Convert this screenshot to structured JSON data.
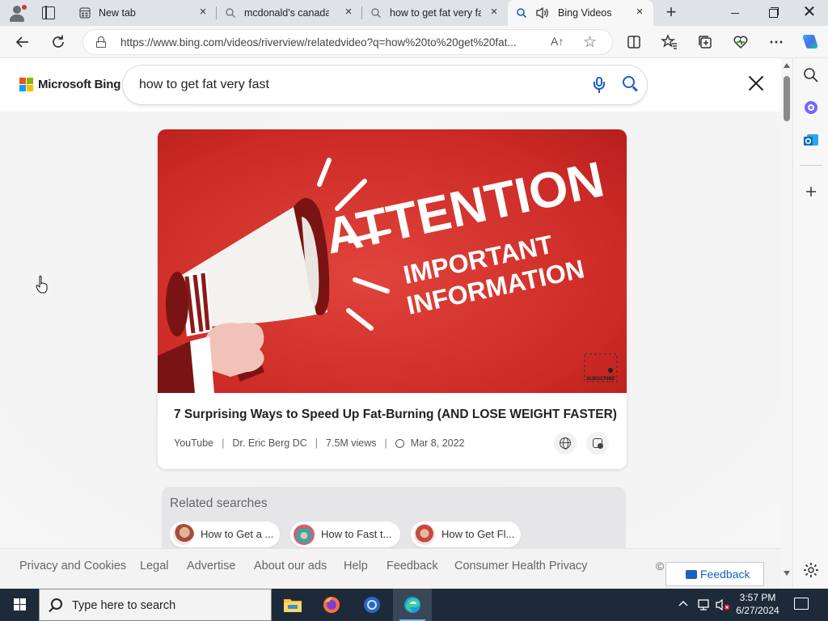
{
  "browser": {
    "tabs": [
      {
        "label": "New tab",
        "icon": "newtab-icon",
        "active": false
      },
      {
        "label": "mcdonald's canada m",
        "icon": "search-icon",
        "active": false
      },
      {
        "label": "how to get fat very fa",
        "icon": "search-icon",
        "active": false
      },
      {
        "label": "Bing Videos",
        "icon": "search-icon",
        "active": true,
        "audio": true
      }
    ],
    "url": "https://www.bing.com/videos/riverview/relatedvideo?q=how%20to%20get%20fat...",
    "readaloud_label": "A↑"
  },
  "bing": {
    "brand": "Microsoft Bing",
    "query": "how to get fat very fast"
  },
  "video": {
    "thumbnail_text": {
      "headline": "ATTENTION",
      "line1": "IMPORTANT",
      "line2": "INFORMATION",
      "corner": "SUBSCRIBE"
    },
    "title": "7 Surprising Ways to Speed Up Fat-Burning (AND LOSE WEIGHT FASTER)",
    "source": "YouTube",
    "channel": "Dr. Eric Berg DC",
    "views": "7.5M views",
    "date": "Mar 8, 2022",
    "separator": "|"
  },
  "related": {
    "title": "Related searches",
    "chips": [
      {
        "label": "How to Get a ..."
      },
      {
        "label": "How to Fast t..."
      },
      {
        "label": "How to Get Fl..."
      }
    ]
  },
  "footer": {
    "links": [
      "Privacy and Cookies",
      "Legal",
      "Advertise",
      "About our ads",
      "Help",
      "Feedback",
      "Consumer Health Privacy"
    ],
    "copyright": "©",
    "feedback_button": "Feedback"
  },
  "taskbar": {
    "search_placeholder": "Type here to search",
    "time": "3:57 PM",
    "date": "6/27/2024"
  },
  "colors": {
    "accent": "#1a5fc2",
    "thumb_red": "#cc2a26",
    "taskbar": "#1d2a3a"
  }
}
